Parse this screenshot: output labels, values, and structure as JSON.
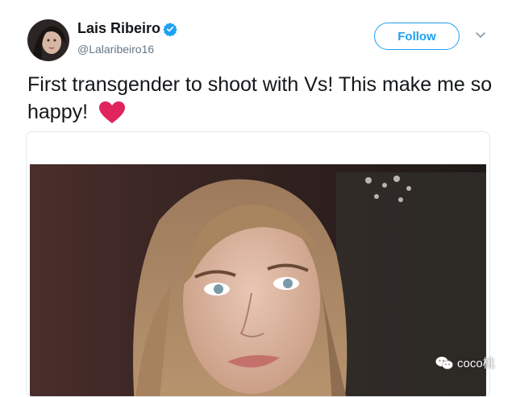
{
  "profile": {
    "display_name": "Lais Ribeiro",
    "handle": "@Lalaribeiro16",
    "verified": true
  },
  "actions": {
    "follow_label": "Follow"
  },
  "tweet": {
    "text": "First transgender to shoot with Vs! This make me so happy!",
    "emoji": "heart-emoji"
  },
  "watermark": {
    "text": "coco桃"
  },
  "colors": {
    "accent": "#1da1f2",
    "heart": "#e0245e",
    "handle_gray": "#657786"
  }
}
